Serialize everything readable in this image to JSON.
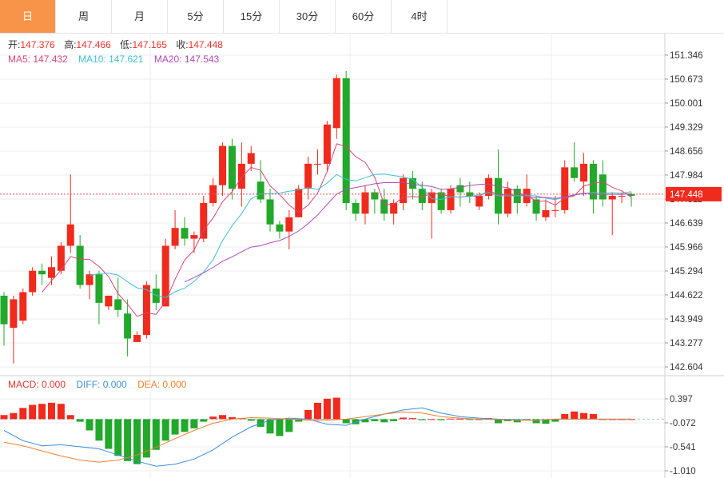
{
  "tabs": [
    {
      "label": "日",
      "active": true
    },
    {
      "label": "周"
    },
    {
      "label": "月"
    },
    {
      "label": "5分"
    },
    {
      "label": "15分"
    },
    {
      "label": "30分"
    },
    {
      "label": "60分"
    },
    {
      "label": "4时"
    }
  ],
  "ohlc_info": {
    "open_label": "开:",
    "open": "147.376",
    "high_label": "高:",
    "high": "147.466",
    "low_label": "低:",
    "low": "147.165",
    "close_label": "收:",
    "close": "147.448"
  },
  "ma_info": {
    "ma5_label": "MA5: ",
    "ma5": "147.432",
    "ma10_label": "MA10: ",
    "ma10": "147.621",
    "ma20_label": "MA20: ",
    "ma20": "147.543"
  },
  "macd_info": {
    "macd_label": "MACD: ",
    "macd": "0.000",
    "diff_label": "DIFF: ",
    "diff": "0.000",
    "dea_label": "DEA: ",
    "dea": "0.000"
  },
  "colors": {
    "up": "#f02a1c",
    "down": "#22a82a",
    "ma5": "#d6457a",
    "ma10": "#3fbfd4",
    "ma20": "#b04ab8",
    "dea": "#f08030",
    "diff": "#3a8ee0",
    "price_line": "#e8525a",
    "grid": "#ececec"
  },
  "chart_data": {
    "type": "candlestick",
    "price_axis": {
      "ticks": [
        "151.346",
        "150.673",
        "150.001",
        "149.329",
        "148.656",
        "147.984",
        "147.311",
        "146.639",
        "145.966",
        "145.294",
        "144.622",
        "143.949",
        "143.277",
        "142.604"
      ],
      "ylim": [
        142.6,
        151.6
      ]
    },
    "macd_axis": {
      "ticks": [
        "0.397",
        "-0.072",
        "-0.541",
        "-1.010"
      ],
      "ylim": [
        -1.01,
        0.6
      ]
    },
    "current_price": "147.448",
    "candles": [
      [
        144.6,
        143.8,
        144.7,
        143.2
      ],
      [
        143.7,
        144.5,
        144.6,
        142.7
      ],
      [
        143.9,
        144.7,
        144.8,
        143.8
      ],
      [
        144.7,
        145.3,
        145.4,
        144.6
      ],
      [
        145.3,
        145.2,
        145.5,
        144.9
      ],
      [
        145.1,
        145.4,
        145.7,
        144.9
      ],
      [
        145.3,
        146.0,
        146.1,
        145.2
      ],
      [
        146.0,
        146.6,
        148.0,
        145.8
      ],
      [
        146.0,
        144.9,
        146.3,
        144.8
      ],
      [
        144.9,
        145.2,
        145.3,
        144.5
      ],
      [
        145.2,
        144.4,
        145.3,
        143.8
      ],
      [
        144.3,
        144.6,
        144.6,
        144.2
      ],
      [
        144.5,
        144.2,
        145.1,
        144.0
      ],
      [
        144.1,
        143.4,
        144.5,
        142.9
      ],
      [
        143.3,
        143.5,
        143.6,
        143.3
      ],
      [
        143.5,
        144.9,
        145.0,
        143.4
      ],
      [
        144.8,
        144.4,
        145.2,
        144.2
      ],
      [
        144.3,
        146.0,
        146.2,
        144.3
      ],
      [
        146.0,
        146.5,
        147.0,
        145.9
      ],
      [
        146.5,
        146.2,
        146.8,
        146.0
      ],
      [
        146.2,
        146.3,
        146.4,
        145.8
      ],
      [
        146.2,
        147.2,
        147.4,
        146.1
      ],
      [
        147.2,
        147.7,
        147.9,
        147.1
      ],
      [
        147.7,
        148.8,
        148.9,
        147.4
      ],
      [
        148.8,
        147.6,
        149.0,
        147.3
      ],
      [
        147.6,
        148.3,
        148.9,
        147.1
      ],
      [
        148.3,
        148.6,
        148.8,
        148.1
      ],
      [
        147.8,
        147.3,
        148.4,
        147.2
      ],
      [
        147.3,
        146.6,
        147.6,
        146.4
      ],
      [
        146.6,
        146.4,
        146.7,
        146.2
      ],
      [
        146.4,
        146.8,
        147.0,
        145.9
      ],
      [
        146.8,
        147.6,
        147.7,
        146.8
      ],
      [
        147.6,
        148.3,
        148.5,
        147.3
      ],
      [
        148.3,
        148.3,
        148.7,
        148.0
      ],
      [
        148.3,
        149.4,
        149.5,
        148.1
      ],
      [
        149.3,
        150.7,
        150.8,
        149.0
      ],
      [
        150.7,
        147.2,
        150.9,
        147.0
      ],
      [
        147.2,
        146.9,
        147.3,
        146.7
      ],
      [
        146.9,
        147.5,
        147.7,
        146.6
      ],
      [
        147.5,
        147.3,
        147.6,
        146.9
      ],
      [
        147.3,
        146.9,
        147.6,
        146.7
      ],
      [
        146.9,
        147.2,
        147.3,
        146.6
      ],
      [
        147.2,
        147.9,
        148.0,
        147.0
      ],
      [
        147.9,
        147.6,
        148.1,
        147.3
      ],
      [
        147.6,
        147.2,
        147.8,
        147.0
      ],
      [
        147.2,
        147.5,
        147.6,
        146.2
      ],
      [
        147.5,
        147.0,
        147.6,
        146.9
      ],
      [
        147.0,
        147.6,
        147.7,
        146.9
      ],
      [
        147.7,
        147.5,
        147.9,
        147.1
      ],
      [
        147.5,
        147.4,
        147.8,
        147.2
      ],
      [
        147.1,
        147.4,
        147.5,
        147.0
      ],
      [
        147.4,
        147.9,
        148.0,
        147.3
      ],
      [
        147.9,
        146.9,
        148.7,
        146.6
      ],
      [
        146.9,
        147.6,
        147.8,
        146.8
      ],
      [
        147.6,
        147.2,
        147.7,
        146.9
      ],
      [
        147.2,
        147.6,
        148.0,
        147.1
      ],
      [
        147.3,
        146.9,
        147.4,
        146.7
      ],
      [
        146.8,
        147.0,
        147.3,
        146.7
      ],
      [
        147.0,
        147.0,
        147.4,
        146.8
      ],
      [
        147.0,
        148.2,
        148.4,
        146.9
      ],
      [
        148.2,
        147.9,
        148.9,
        147.8
      ],
      [
        147.8,
        148.3,
        148.6,
        147.4
      ],
      [
        148.3,
        147.3,
        148.4,
        146.9
      ],
      [
        148.0,
        147.3,
        148.4,
        147.1
      ],
      [
        147.3,
        147.4,
        147.5,
        146.3
      ],
      [
        147.4,
        147.4,
        147.5,
        147.2
      ],
      [
        147.45,
        147.4,
        147.5,
        147.1
      ]
    ],
    "macd_hist": [
      0.08,
      0.12,
      0.22,
      0.28,
      0.3,
      0.32,
      0.3,
      0.08,
      -0.05,
      -0.22,
      -0.42,
      -0.58,
      -0.72,
      -0.82,
      -0.88,
      -0.75,
      -0.6,
      -0.42,
      -0.3,
      -0.25,
      -0.18,
      -0.05,
      0.05,
      0.08,
      0.04,
      0.02,
      -0.03,
      -0.15,
      -0.28,
      -0.33,
      -0.25,
      -0.05,
      0.18,
      0.32,
      0.4,
      0.42,
      -0.08,
      -0.1,
      -0.06,
      -0.04,
      -0.06,
      -0.04,
      0.03,
      0.02,
      -0.02,
      0.0,
      -0.02,
      0.01,
      0.01,
      -0.01,
      0.0,
      0.02,
      -0.08,
      -0.04,
      -0.06,
      -0.02,
      -0.08,
      -0.09,
      -0.05,
      0.1,
      0.15,
      0.12,
      0.1,
      0.0,
      0.0,
      0.0,
      0.0
    ],
    "diff_line": [
      -0.22,
      -0.42,
      -0.52,
      -0.5,
      -0.54,
      -0.58,
      -0.7,
      -0.82,
      -0.92,
      -0.88,
      -0.78,
      -0.6,
      -0.35,
      -0.15,
      -0.02,
      0.02,
      0.0,
      -0.1,
      -0.12,
      0.0,
      0.1,
      0.18,
      0.22,
      0.12,
      0.05,
      0.02,
      0.0,
      -0.01,
      -0.02,
      0.0,
      0.0,
      0.0,
      0.0,
      0.0
    ],
    "dea_line": [
      -0.45,
      -0.52,
      -0.62,
      -0.72,
      -0.8,
      -0.84,
      -0.8,
      -0.7,
      -0.55,
      -0.38,
      -0.22,
      -0.08,
      0.0,
      0.03,
      0.02,
      0.0,
      -0.02,
      -0.02,
      0.0,
      0.05,
      0.1,
      0.14,
      0.12,
      0.05,
      0.02,
      0.0,
      -0.01,
      -0.02,
      -0.02,
      0.0,
      0.0,
      0.0,
      0.0,
      0.0
    ]
  }
}
